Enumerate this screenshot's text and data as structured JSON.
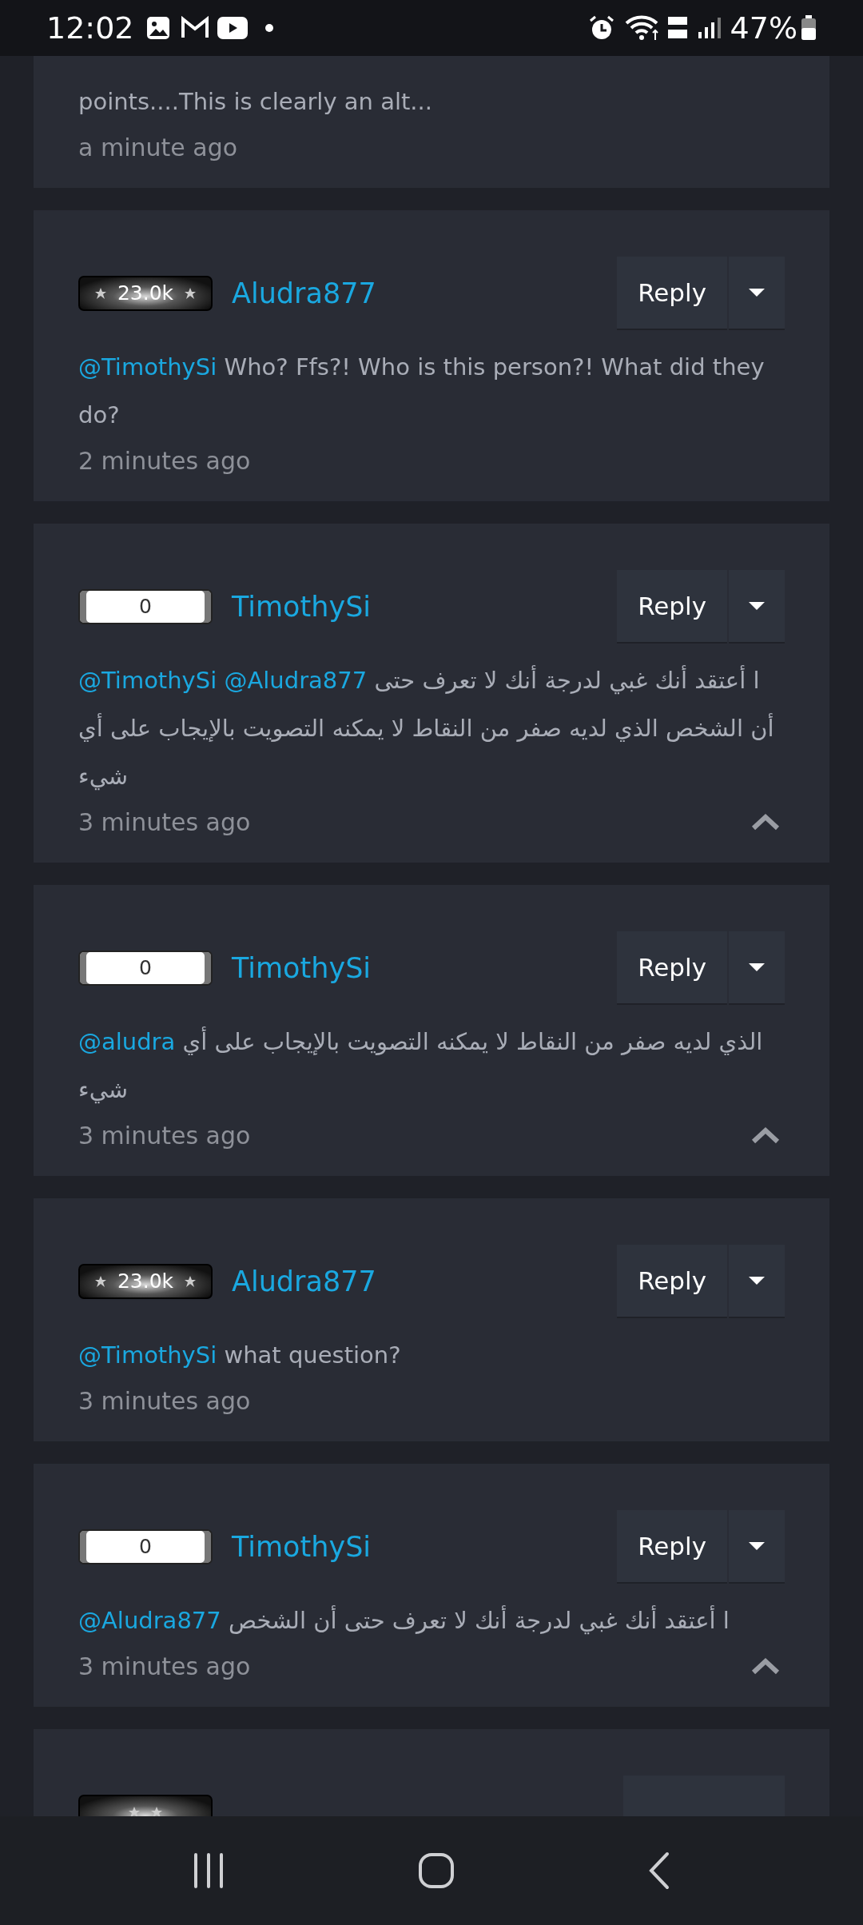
{
  "status_bar": {
    "time": "12:02",
    "battery": "47%"
  },
  "comments": [
    {
      "cut_top": true,
      "text_lines": [
        "points....This is clearly an alt..."
      ],
      "time": "a minute ago",
      "toggle": false
    },
    {
      "badge": {
        "kind": "stars",
        "label": "23.0k"
      },
      "user": "Aludra877",
      "reply": "Reply",
      "mentions": [
        "@TimothySi"
      ],
      "text": "Who? Ffs?! Who is this person?! What did they do?",
      "time": "2 minutes ago",
      "toggle": false
    },
    {
      "badge": {
        "kind": "plain",
        "label": "0"
      },
      "user": "TimothySi",
      "reply": "Reply",
      "mentions": [
        "@TimothySi",
        "@Aludra877"
      ],
      "text": "ا أعتقد أنك غبي لدرجة أنك لا تعرف حتى أن الشخص الذي لديه صفر من النقاط لا يمكنه التصويت بالإيجاب على أي شيء",
      "time": "3 minutes ago",
      "toggle": true
    },
    {
      "badge": {
        "kind": "plain",
        "label": "0"
      },
      "user": "TimothySi",
      "reply": "Reply",
      "mentions": [
        "@aludra"
      ],
      "text": "الذي لديه صفر من النقاط لا يمكنه التصويت بالإيجاب على أي شيء",
      "time": "3 minutes ago",
      "toggle": true
    },
    {
      "badge": {
        "kind": "stars",
        "label": "23.0k"
      },
      "user": "Aludra877",
      "reply": "Reply",
      "mentions": [
        "@TimothySi"
      ],
      "text": "what question?",
      "time": "3 minutes ago",
      "toggle": false
    },
    {
      "badge": {
        "kind": "plain",
        "label": "0"
      },
      "user": "TimothySi",
      "reply": "Reply",
      "mentions": [
        "@Aludra877"
      ],
      "text": "ا أعتقد أنك غبي لدرجة أنك لا تعرف حتى أن الشخص",
      "time": "3 minutes ago",
      "toggle": true
    },
    {
      "cut_bottom": true,
      "badge": {
        "kind": "stars"
      }
    }
  ]
}
